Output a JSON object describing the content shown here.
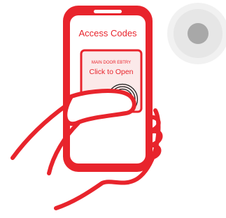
{
  "phone": {
    "title": "Access Codes",
    "card": {
      "subtitle": "MAIN DOOR EBTRY",
      "action": "Click to Open"
    }
  },
  "colors": {
    "accent": "#e8242c",
    "screen": "#ffffff",
    "card_fill": "#fbe9e9",
    "fingerprint": "#1a1a1a",
    "button_outer": "#ececec",
    "button_inner": "#a8a8a8"
  },
  "icons": {
    "fingerprint": "fingerprint-icon",
    "hand": "hand-illustration",
    "round_button": "round-button"
  }
}
